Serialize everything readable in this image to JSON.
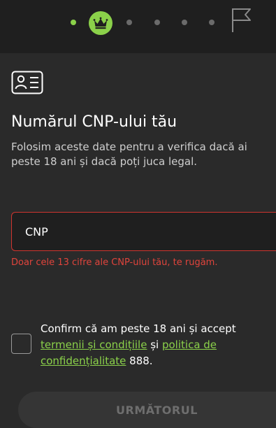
{
  "progress": {
    "steps": [
      "done",
      "current",
      "pending",
      "pending",
      "pending",
      "pending",
      "finish"
    ],
    "current_icon": "crown-icon",
    "finish_icon": "flag-icon",
    "accent_color": "#8bd14a"
  },
  "form": {
    "icon": "id-card-icon",
    "title": "Numărul CNP-ului tău",
    "subtitle": "Folosim aceste date pentru a verifica dacă ai peste 18 ani și dacă poți juca legal.",
    "cnp_field": {
      "placeholder": "CNP",
      "value": "",
      "state": "error",
      "error_color": "#d0352f"
    },
    "error_message": "Doar cele 13 cifre ale CNP-ului tău, te rugăm.",
    "consent": {
      "checked": false,
      "text_before": "Confirm că am peste 18 ani și accept ",
      "terms_link": "termenii și condițiile",
      "text_middle": " și ",
      "privacy_link": "politica de confidențialitate",
      "text_after": " 888."
    },
    "next_button": "URMĂTORUL"
  }
}
